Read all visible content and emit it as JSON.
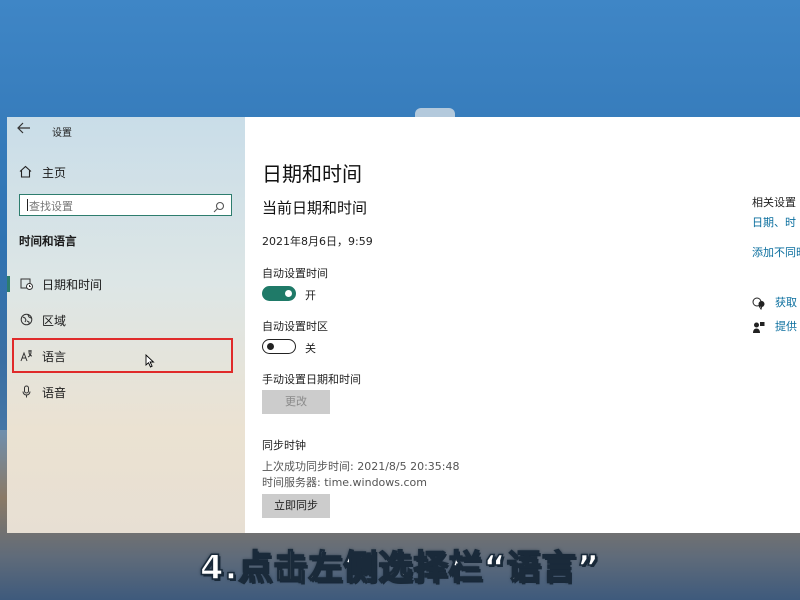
{
  "window": {
    "title": "设置",
    "back_icon": "back-arrow-icon"
  },
  "sidebar": {
    "home_label": "主页",
    "search_placeholder": "查找设置",
    "section_title": "时间和语言",
    "items": [
      {
        "label": "日期和时间",
        "icon": "calendar-clock-icon",
        "active": true
      },
      {
        "label": "区域",
        "icon": "globe-icon",
        "active": false
      },
      {
        "label": "语言",
        "icon": "language-icon",
        "active": false
      },
      {
        "label": "语音",
        "icon": "microphone-icon",
        "active": false
      }
    ]
  },
  "main": {
    "title": "日期和时间",
    "current_heading": "当前日期和时间",
    "current_datetime": "2021年8月6日，9:59",
    "auto_time": {
      "label": "自动设置时间",
      "state_label": "开",
      "on": true
    },
    "auto_zone": {
      "label": "自动设置时区",
      "state_label": "关",
      "on": false
    },
    "manual": {
      "label": "手动设置日期和时间",
      "button": "更改"
    },
    "sync": {
      "heading": "同步时钟",
      "last_sync": "上次成功同步时间: 2021/8/5 20:35:48",
      "server": "时间服务器: time.windows.com",
      "button": "立即同步"
    }
  },
  "related": {
    "title": "相关设置",
    "link1": "日期、时",
    "link2": "添加不同时",
    "help1": "获取",
    "help2": "提供"
  },
  "caption": "4.点击左侧选择栏“语言”",
  "colors": {
    "accent": "#2d7d6e",
    "toggle_on": "#1f7a68",
    "highlight_box": "#e02a2a",
    "link": "#0a6e9e"
  }
}
